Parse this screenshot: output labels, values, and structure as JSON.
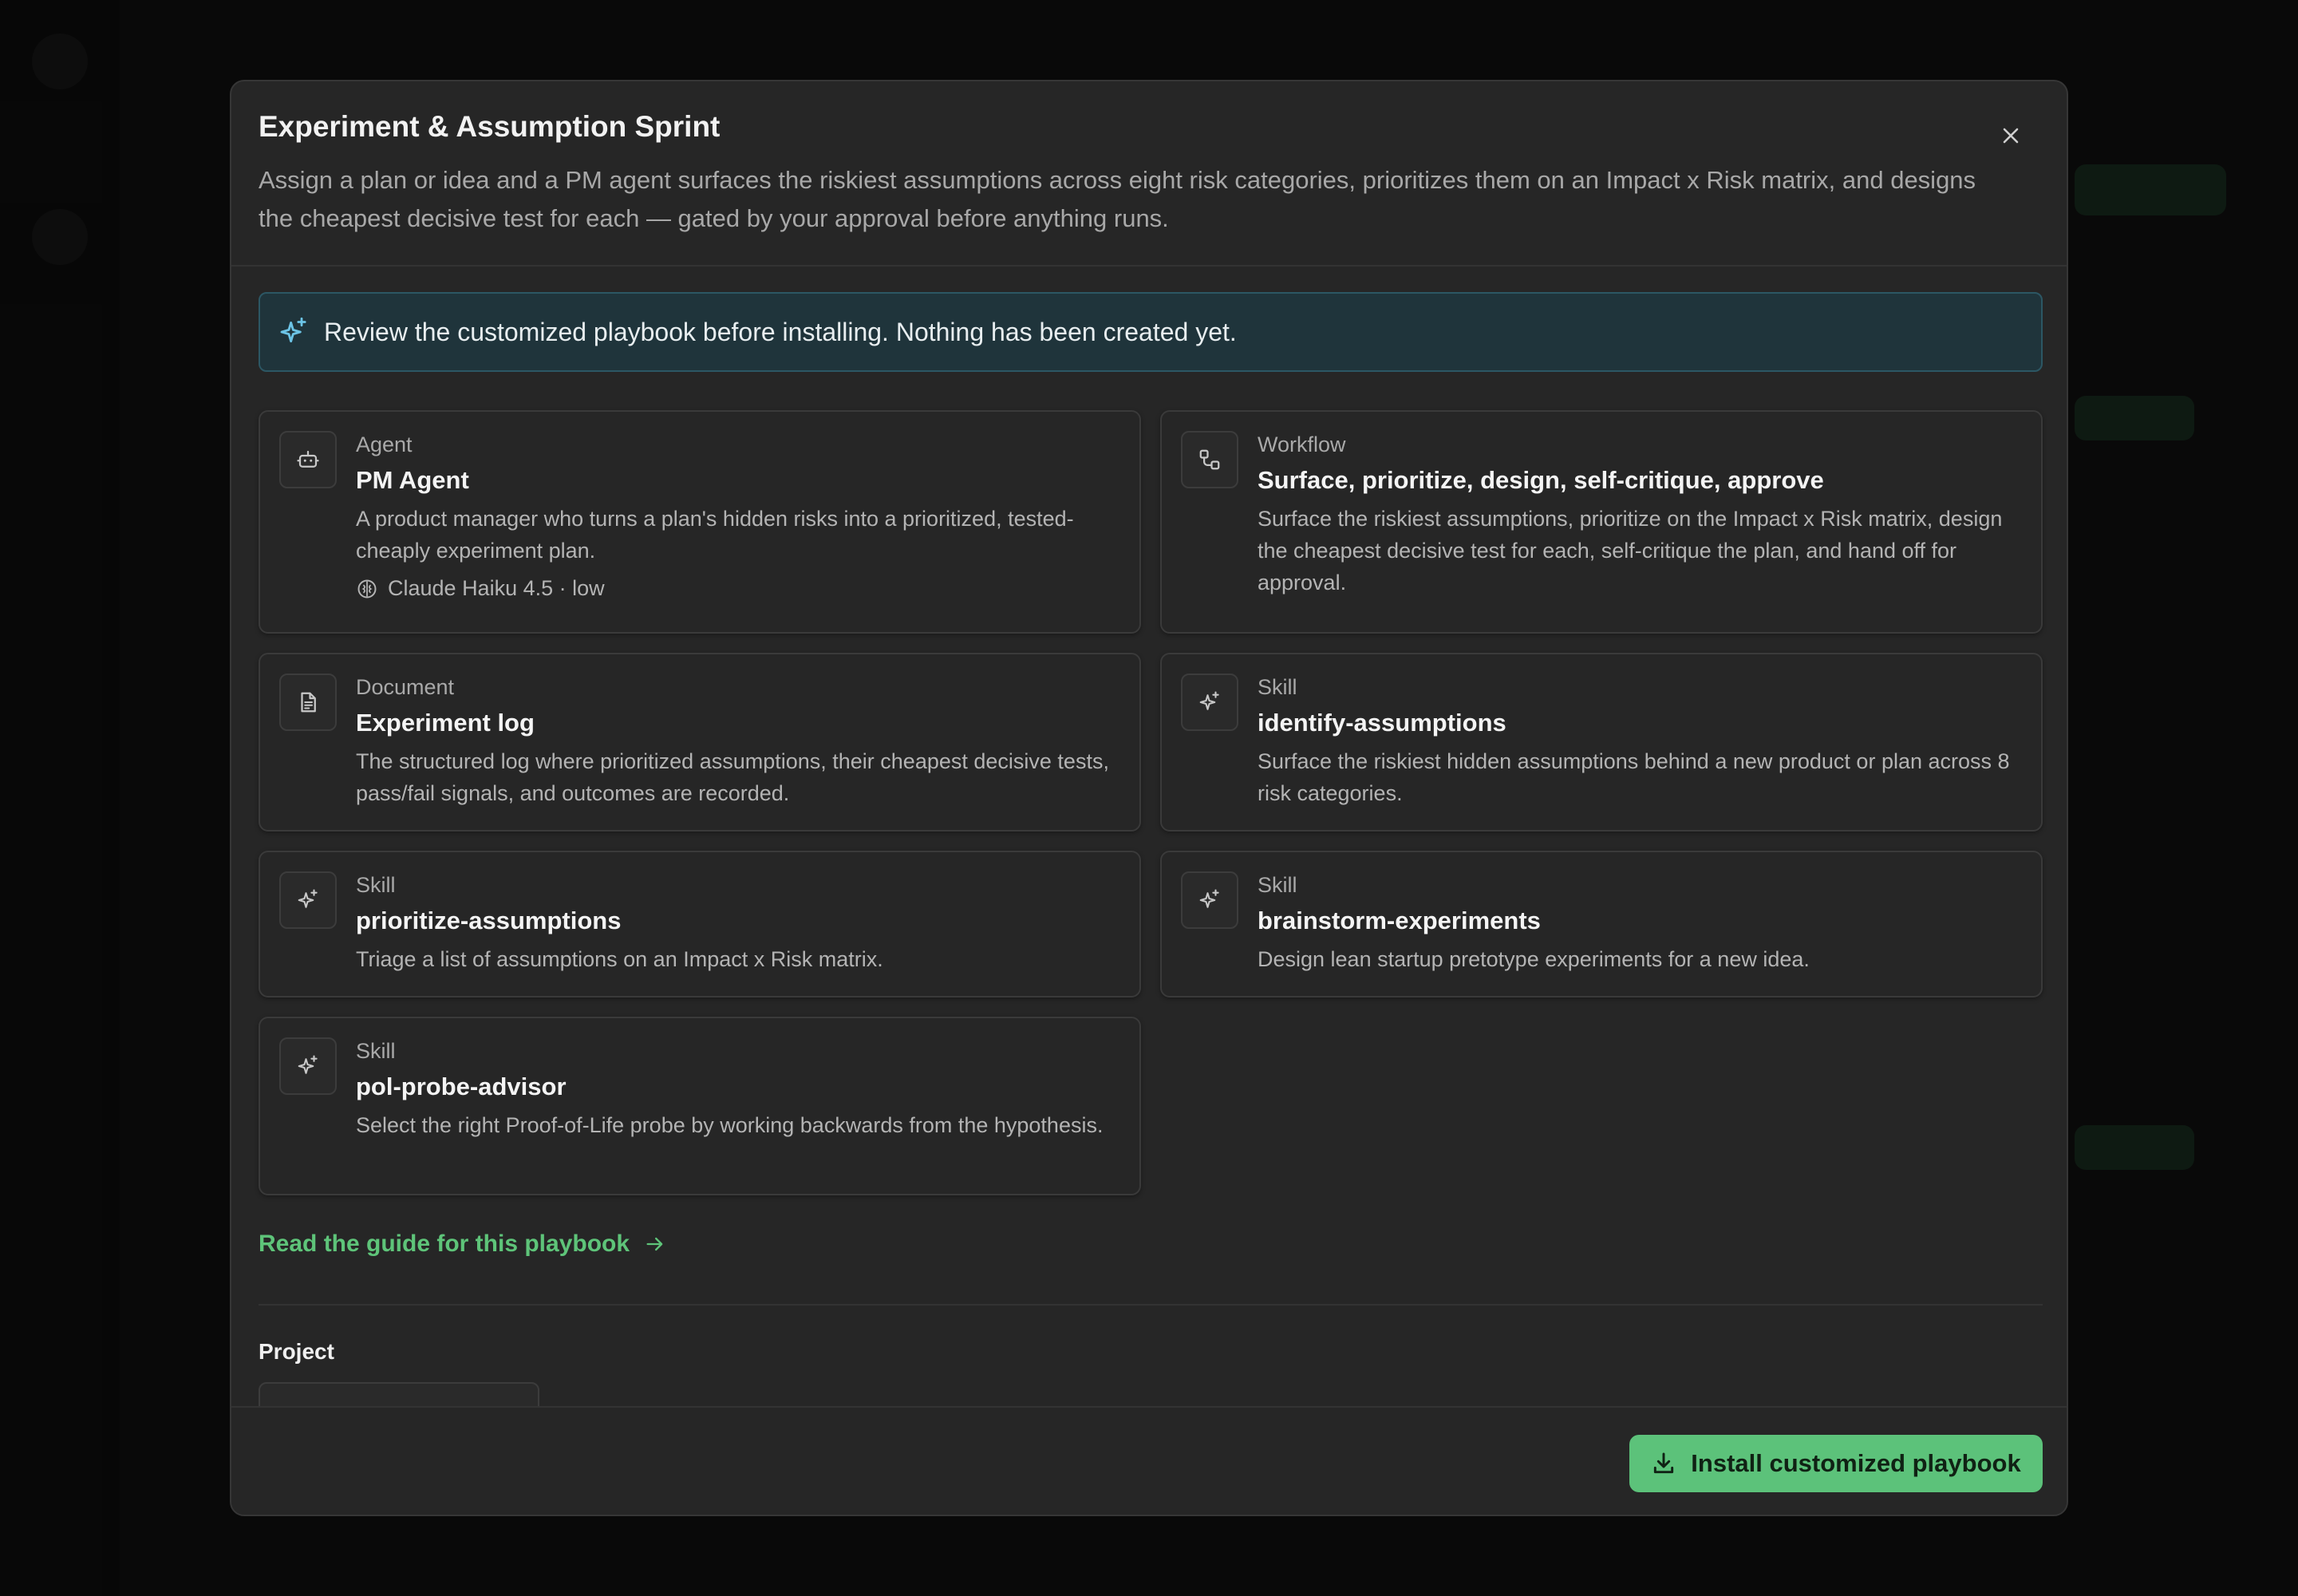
{
  "modal": {
    "title": "Experiment & Assumption Sprint",
    "description": "Assign a plan or idea and a PM agent surfaces the riskiest assumptions across eight risk categories, prioritizes them on an Impact x Risk matrix, and designs the cheapest decisive test for each — gated by your approval before anything runs."
  },
  "notice": {
    "text": "Review the customized playbook before installing. Nothing has been created yet.",
    "accent_color": "#6cc4e6"
  },
  "cards": [
    {
      "kind": "Agent",
      "name": "PM Agent",
      "description": "A product manager who turns a plan's hidden risks into a prioritized, tested-cheaply experiment plan.",
      "meta": "Claude Haiku 4.5 · low",
      "icon": "bot-icon"
    },
    {
      "kind": "Workflow",
      "name": "Surface, prioritize, design, self-critique, approve",
      "description": "Surface the riskiest assumptions, prioritize on the Impact x Risk matrix, design the cheapest decisive test for each, self-critique the plan, and hand off for approval.",
      "icon": "workflow-icon"
    },
    {
      "kind": "Document",
      "name": "Experiment log",
      "description": "The structured log where prioritized assumptions, their cheapest decisive tests, pass/fail signals, and outcomes are recorded.",
      "icon": "document-icon"
    },
    {
      "kind": "Skill",
      "name": "identify-assumptions",
      "description": "Surface the riskiest hidden assumptions behind a new product or plan across 8 risk categories.",
      "icon": "sparkle-icon"
    },
    {
      "kind": "Skill",
      "name": "prioritize-assumptions",
      "description": "Triage a list of assumptions on an Impact x Risk matrix.",
      "icon": "sparkle-icon"
    },
    {
      "kind": "Skill",
      "name": "brainstorm-experiments",
      "description": "Design lean startup pretotype experiments for a new idea.",
      "icon": "sparkle-icon"
    },
    {
      "kind": "Skill",
      "name": "pol-probe-advisor",
      "description": "Select the right Proof-of-Life probe by working backwards from the hypothesis.",
      "icon": "sparkle-icon"
    }
  ],
  "guide_link": "Read the guide for this playbook",
  "project": {
    "label": "Project"
  },
  "footer": {
    "install_label": "Install customized playbook",
    "accent_color": "#5cc27a"
  }
}
